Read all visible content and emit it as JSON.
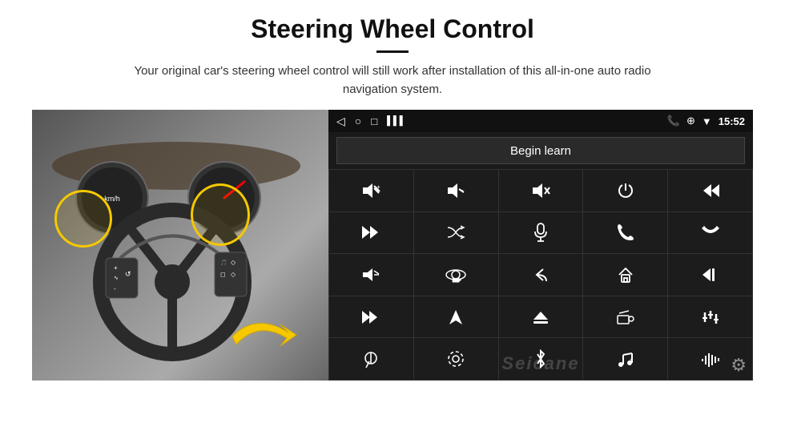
{
  "header": {
    "title": "Steering Wheel Control",
    "subtitle": "Your original car's steering wheel control will still work after installation of this all-in-one auto radio navigation system."
  },
  "status_bar": {
    "nav_back": "◁",
    "nav_home_circle": "○",
    "nav_square": "□",
    "signal_icon": "▌▌",
    "phone_icon": "📞",
    "location_icon": "⊕",
    "wifi_icon": "▼",
    "time": "15:52"
  },
  "begin_learn_btn": "Begin learn",
  "watermark": "Seicane",
  "controls": [
    {
      "icon": "🔊+",
      "row": 1,
      "col": 1
    },
    {
      "icon": "🔊-",
      "row": 1,
      "col": 2
    },
    {
      "icon": "🔇",
      "row": 1,
      "col": 3
    },
    {
      "icon": "⏻",
      "row": 1,
      "col": 4
    },
    {
      "icon": "⏭",
      "row": 1,
      "col": 5
    },
    {
      "icon": "⏭",
      "row": 2,
      "col": 1
    },
    {
      "icon": "⏭✗",
      "row": 2,
      "col": 2
    },
    {
      "icon": "🎤",
      "row": 2,
      "col": 3
    },
    {
      "icon": "📞",
      "row": 2,
      "col": 4
    },
    {
      "icon": "↩",
      "row": 2,
      "col": 5
    },
    {
      "icon": "🔈",
      "row": 3,
      "col": 1
    },
    {
      "icon": "360°",
      "row": 3,
      "col": 2
    },
    {
      "icon": "↩",
      "row": 3,
      "col": 3
    },
    {
      "icon": "⌂",
      "row": 3,
      "col": 4
    },
    {
      "icon": "⏮",
      "row": 3,
      "col": 5
    },
    {
      "icon": "⏭",
      "row": 4,
      "col": 1
    },
    {
      "icon": "▶",
      "row": 4,
      "col": 2
    },
    {
      "icon": "⊖",
      "row": 4,
      "col": 3
    },
    {
      "icon": "📻",
      "row": 4,
      "col": 4
    },
    {
      "icon": "⚙",
      "row": 4,
      "col": 5
    },
    {
      "icon": "🎤",
      "row": 5,
      "col": 1
    },
    {
      "icon": "⊛",
      "row": 5,
      "col": 2
    },
    {
      "icon": "✱",
      "row": 5,
      "col": 3
    },
    {
      "icon": "♫",
      "row": 5,
      "col": 4
    },
    {
      "icon": "▐▐▐",
      "row": 5,
      "col": 5
    }
  ]
}
